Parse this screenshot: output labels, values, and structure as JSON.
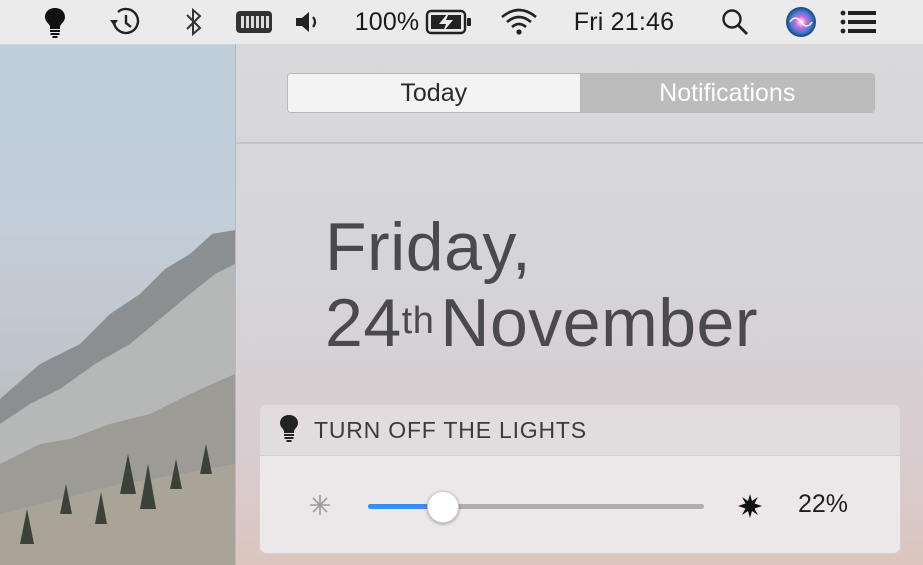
{
  "menubar": {
    "battery_percent": "100%",
    "clock": "Fri 21:46",
    "icons": [
      "lightbulb-icon",
      "time-machine-icon",
      "bluetooth-icon",
      "battery-meter-icon",
      "volume-icon",
      "battery-charging-icon",
      "wifi-icon",
      "spotlight-search-icon",
      "siri-icon",
      "notification-center-icon"
    ]
  },
  "notification_center": {
    "tabs": [
      {
        "label": "Today",
        "selected": true
      },
      {
        "label": "Notifications",
        "selected": false
      }
    ],
    "date": {
      "weekday": "Friday,",
      "day": "24",
      "suffix": "th",
      "month": "November"
    },
    "widget": {
      "title": "TURN OFF THE LIGHTS",
      "brightness_value": 0.22,
      "brightness_label": "22%",
      "icons": [
        "lightbulb-icon",
        "dim-sun-icon",
        "bright-sun-icon"
      ]
    }
  },
  "colors": {
    "accent": "#3b8ef1",
    "menubar": "#ebebeb",
    "selected_tab": "#f3f3f3",
    "unselected_tab": "#bcbcbc"
  }
}
